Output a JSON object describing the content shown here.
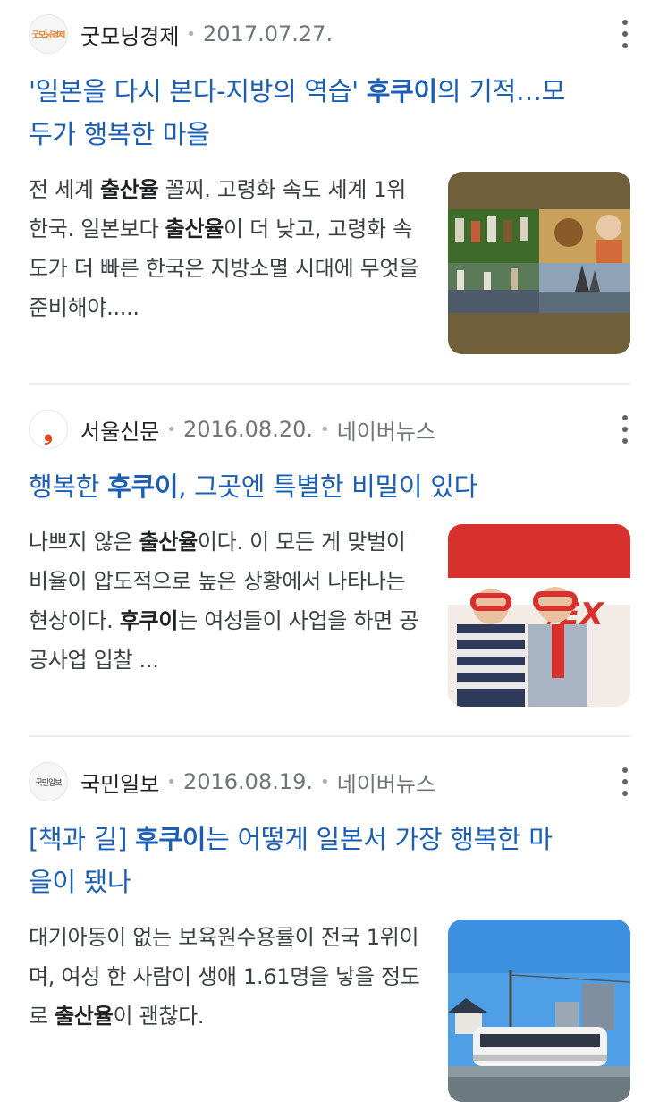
{
  "results": [
    {
      "favicon_text": "굿모닝경제",
      "source": "굿모닝경제",
      "date": "2017.07.27.",
      "title_pre": "'일본을 다시 본다-지방의 역습' ",
      "title_bold": "후쿠이",
      "title_line1_post": "의 기적…모",
      "title_line2": "두가 행복한 마을",
      "snippet_a": "전 세계 ",
      "snippet_b1": "출산율",
      "snippet_c": " 꼴찌. 고령화 속도 세계 1위 한국. 일본보다 ",
      "snippet_b2": "출산율",
      "snippet_d": "이 더 낮고, 고령화 속도가 더 빠른 한국은 지방소멸 시대에 무엇을 준비해야.....",
      "thumb_icon": "festival-collage-thumbnail"
    },
    {
      "favicon_text": "❟",
      "source": "서울신문",
      "date": "2016.08.20.",
      "extra": "네이버뉴스",
      "title_pre": "행복한 ",
      "title_bold": "후쿠이",
      "title_post": ", 그곳엔 특별한 비밀이 있다",
      "snippet_a": "나쁘지 않은 ",
      "snippet_b1": "출산율",
      "snippet_c": "이다. 이 모든 게 맞벌이 비율이 압도적으로 높은 상황에서 나타나는 현상이다. ",
      "snippet_b2": "후쿠이",
      "snippet_d": "는 여성들이 사업을 하면 공공사업 입찰 ...",
      "thumb_icon": "glasses-men-thumbnail"
    },
    {
      "favicon_text": "국민일보",
      "source": "국민일보",
      "date": "2016.08.19.",
      "extra": "네이버뉴스",
      "title_pre": "[책과 길] ",
      "title_bold": "후쿠이",
      "title_line1_post": "는 어떻게 일본서 가장 행복한 마",
      "title_line2": "을이 됐나",
      "snippet_a": "대기아동이 없는 보육원수용률이 전국 1위이며, 여성 한 사람이 생애 1.61명을 낳을 정도로 ",
      "snippet_b1": "출산율",
      "snippet_c": "이 괜찮다.",
      "thumb_icon": "tram-city-thumbnail"
    }
  ]
}
